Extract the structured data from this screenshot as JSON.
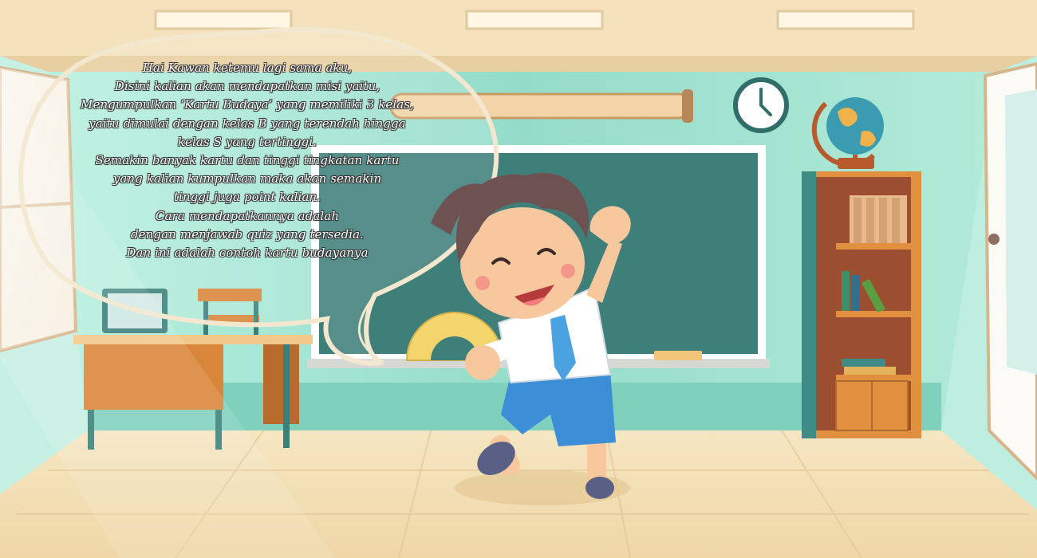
{
  "speech": {
    "lines": [
      "Hai Kawan ketemu lagi sama aku,",
      "Disini kalian akan mendapatkan misi yaitu,",
      "Mengumpulkan ‘Kartu Budaya’ yang memiliki 3 kelas,",
      "yaitu dimulai dengan kelas B yang terendah hingga",
      "kelas S yang tertinggi.",
      "Semakin banyak kartu dan tinggi tingkatan kartu",
      "yang kalian kumpulkan maka akan semakin",
      "tinggi juga point kalian.",
      "Cara mendapatkannya adalah",
      "dengan menjawab quiz yang tersedia.",
      "Dan ini adalah contoh kartu budayanya"
    ]
  },
  "colors": {
    "wall": "#9fe3d0",
    "ceiling": "#f3dfb8",
    "floor": "#f0dcae",
    "chalkboard": "#3f7f79",
    "board_frame": "#ffffff",
    "desk": "#d98a3c",
    "shelf": "#b0653a",
    "shirt": "#ffffff",
    "shorts": "#3c8fd6",
    "tie": "#4aa3e0"
  },
  "icons": {
    "clock": "clock-icon",
    "globe": "globe-icon"
  }
}
